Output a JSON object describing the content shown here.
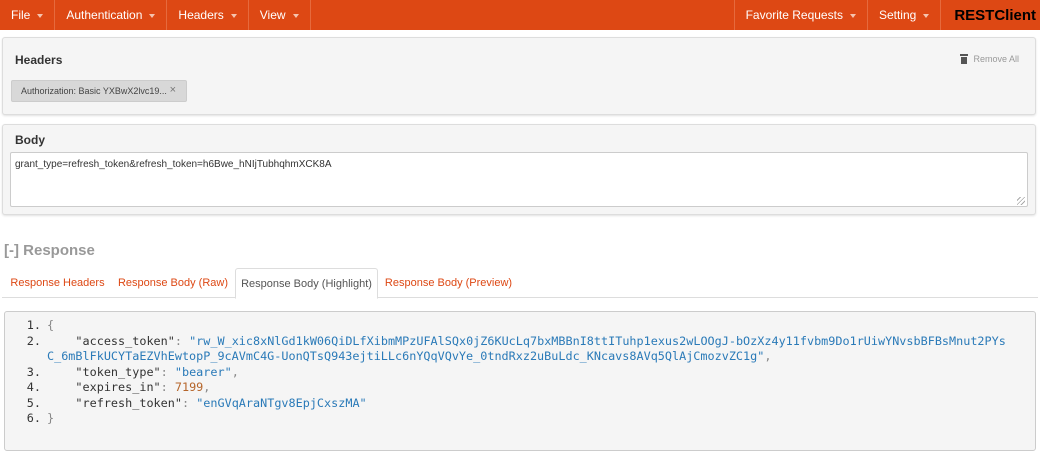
{
  "navbar": {
    "left": [
      {
        "label": "File"
      },
      {
        "label": "Authentication"
      },
      {
        "label": "Headers"
      },
      {
        "label": "View"
      }
    ],
    "right": [
      {
        "label": "Favorite Requests"
      },
      {
        "label": "Setting"
      }
    ],
    "brand": "RESTClient"
  },
  "headers_panel": {
    "title": "Headers",
    "remove_all": "Remove All",
    "tags": [
      {
        "label": "Authorization: Basic YXBwX2lvc19..."
      }
    ]
  },
  "body_panel": {
    "title": "Body",
    "value": "grant_type=refresh_token&refresh_token=h6Bwe_hNIjTubhqhmXCK8A"
  },
  "response": {
    "title": "[-] Response",
    "tabs": [
      {
        "label": "Response Headers",
        "active": false
      },
      {
        "label": "Response Body (Raw)",
        "active": false
      },
      {
        "label": "Response Body (Highlight)",
        "active": true
      },
      {
        "label": "Response Body (Preview)",
        "active": false
      }
    ],
    "code": {
      "line_numbers": [
        "1.",
        "2.",
        "3.",
        "4.",
        "5.",
        "6."
      ],
      "open_brace": "{",
      "close_brace": "}",
      "access_token_key": "\"access_token\"",
      "access_token_value": "\"rw_W_xic8xNlGd1kW06QiDLfXibmMPzUFAlSQx0jZ6KUcLq7bxMBBnI8ttITuhp1exus2wLOOgJ-bOzXz4y11fvbm9Do1rUiwYNvsbBFBsMnut2PYsC_6mBlFkUCYTaEZVhEwtopP_9cAVmC4G-UonQTsQ943ejtiLLc6nYQqVQvYe_0tndRxz2uBuLdc_KNcavs8AVq5QlAjCmozvZC1g\"",
      "token_type_key": "\"token_type\"",
      "token_type_value": "\"bearer\"",
      "expires_in_key": "\"expires_in\"",
      "expires_in_value": "7199",
      "refresh_token_key": "\"refresh_token\"",
      "refresh_token_value": "\"enGVqAraNTgv8EpjCxszMA\""
    }
  },
  "colors": {
    "navbar": "#dd4814",
    "accent_text": "#dd4814",
    "json_string": "#2a7ab8",
    "json_number": "#b5652a"
  }
}
